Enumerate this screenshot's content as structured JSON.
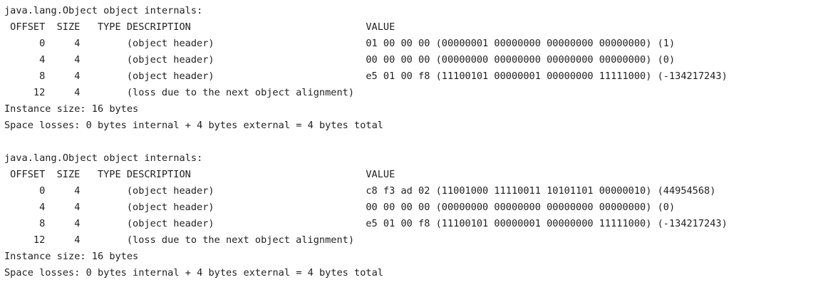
{
  "blocks": [
    {
      "title": "java.lang.Object object internals:",
      "headers": {
        "offset": "OFFSET",
        "size": "SIZE",
        "type": "TYPE",
        "description": "DESCRIPTION",
        "value": "VALUE"
      },
      "rows": [
        {
          "offset": "0",
          "size": "4",
          "type": "",
          "description": "(object header)",
          "value": "01 00 00 00 (00000001 00000000 00000000 00000000) (1)"
        },
        {
          "offset": "4",
          "size": "4",
          "type": "",
          "description": "(object header)",
          "value": "00 00 00 00 (00000000 00000000 00000000 00000000) (0)"
        },
        {
          "offset": "8",
          "size": "4",
          "type": "",
          "description": "(object header)",
          "value": "e5 01 00 f8 (11100101 00000001 00000000 11111000) (-134217243)"
        },
        {
          "offset": "12",
          "size": "4",
          "type": "",
          "description": "(loss due to the next object alignment)",
          "value": ""
        }
      ],
      "instance_size": "Instance size: 16 bytes",
      "space_losses": "Space losses: 0 bytes internal + 4 bytes external = 4 bytes total"
    },
    {
      "title": "java.lang.Object object internals:",
      "headers": {
        "offset": "OFFSET",
        "size": "SIZE",
        "type": "TYPE",
        "description": "DESCRIPTION",
        "value": "VALUE"
      },
      "rows": [
        {
          "offset": "0",
          "size": "4",
          "type": "",
          "description": "(object header)",
          "value": "c8 f3 ad 02 (11001000 11110011 10101101 00000010) (44954568)"
        },
        {
          "offset": "4",
          "size": "4",
          "type": "",
          "description": "(object header)",
          "value": "00 00 00 00 (00000000 00000000 00000000 00000000) (0)"
        },
        {
          "offset": "8",
          "size": "4",
          "type": "",
          "description": "(object header)",
          "value": "e5 01 00 f8 (11100101 00000001 00000000 11111000) (-134217243)"
        },
        {
          "offset": "12",
          "size": "4",
          "type": "",
          "description": "(loss due to the next object alignment)",
          "value": ""
        }
      ],
      "instance_size": "Instance size: 16 bytes",
      "space_losses": "Space losses: 0 bytes internal + 4 bytes external = 4 bytes total"
    }
  ]
}
